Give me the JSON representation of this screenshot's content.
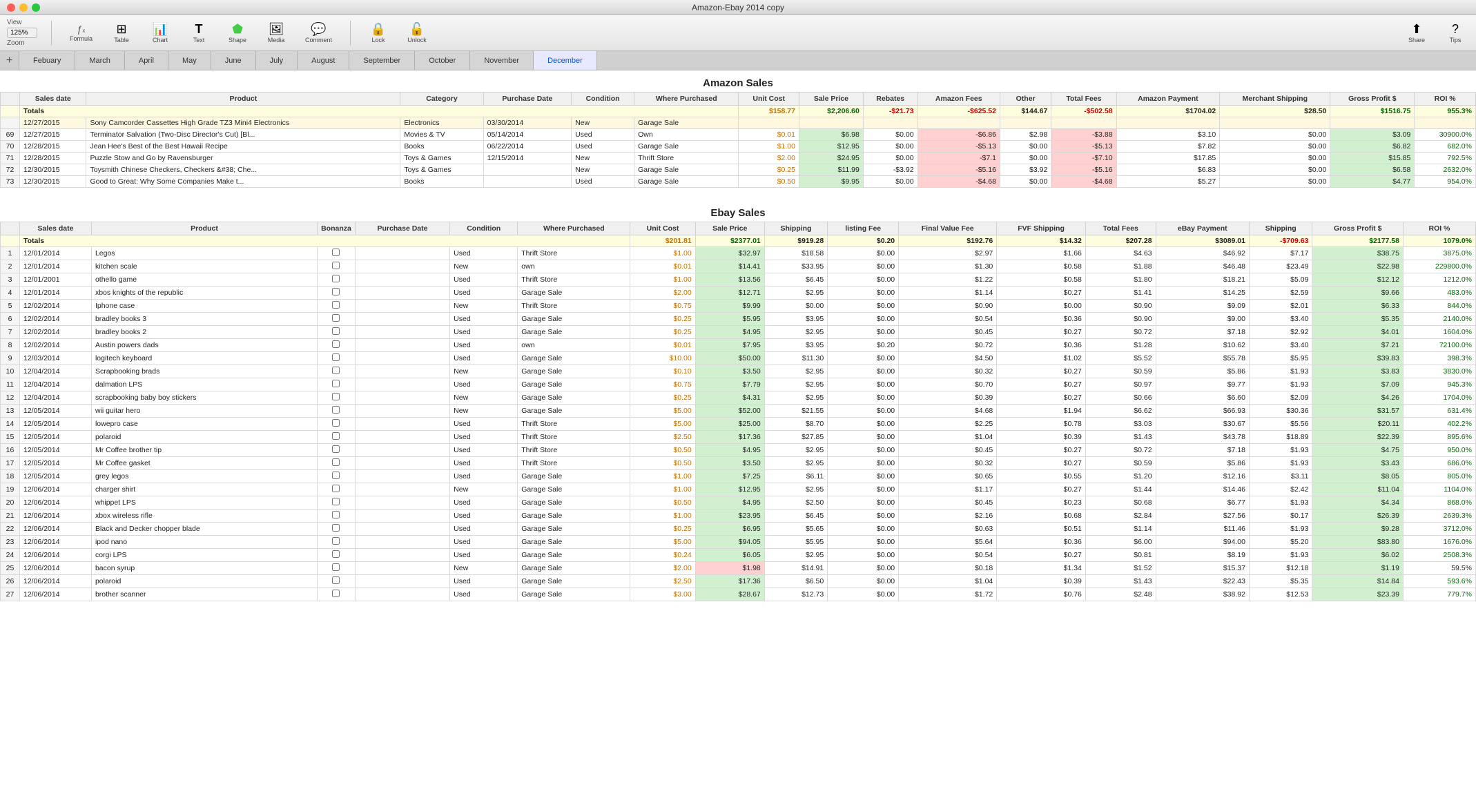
{
  "window": {
    "title": "Amazon-Ebay 2014 copy"
  },
  "toolbar": {
    "view_label": "View",
    "zoom_label": "Zoom",
    "zoom_value": "125%",
    "formula_label": "Formula",
    "table_label": "Table",
    "chart_label": "Chart",
    "text_label": "Text",
    "shape_label": "Shape",
    "media_label": "Media",
    "comment_label": "Comment",
    "lock_label": "Lock",
    "unlock_label": "Unlock",
    "share_label": "Share",
    "tips_label": "Tips"
  },
  "tabs": [
    {
      "label": "Febuary",
      "active": false
    },
    {
      "label": "March",
      "active": false
    },
    {
      "label": "April",
      "active": false
    },
    {
      "label": "May",
      "active": false
    },
    {
      "label": "June",
      "active": false
    },
    {
      "label": "July",
      "active": false
    },
    {
      "label": "August",
      "active": false
    },
    {
      "label": "September",
      "active": false
    },
    {
      "label": "October",
      "active": false
    },
    {
      "label": "November",
      "active": false
    },
    {
      "label": "December",
      "active": true
    }
  ],
  "amazon_section": {
    "title": "Amazon Sales",
    "headers": [
      "Sales date",
      "Product",
      "Category",
      "Purchase Date",
      "Condition",
      "Where Purchased",
      "Unit Cost",
      "Sale Price",
      "Rebates",
      "Amazon Fees",
      "Other",
      "Total Fees",
      "Amazon Payment",
      "Merchant Shipping",
      "Gross Profit $",
      "ROI %"
    ],
    "totals": {
      "label": "Totals",
      "values": [
        "",
        "",
        "",
        "",
        "",
        "$158.77",
        "$2,206.60",
        "-$21.73",
        "-$625.52",
        "$144.67",
        "-$502.58",
        "$1704.02",
        "$28.50",
        "$1516.75",
        "955.3%"
      ]
    },
    "rows": [
      {
        "num": "",
        "date": "12/27/2015",
        "product": "Sony Camcorder Cassettes High Grade TZ3 Mini4 Electronics",
        "category": "Electronics",
        "purchase_date": "03/30/2014",
        "condition": "New",
        "where": "Garage Sale",
        "unit": "",
        "sale": "",
        "rebates": "",
        "amzfee": "",
        "other": "",
        "total": "",
        "payment": "",
        "shipping": "",
        "gross": "",
        "roi": ""
      },
      {
        "num": "69",
        "date": "12/27/2015",
        "product": "Terminator Salvation (Two-Disc Director's Cut) [Bl...",
        "category": "Movies & TV",
        "purchase_date": "05/14/2014",
        "condition": "Used",
        "where": "Own",
        "unit": "$0.01",
        "sale": "$6.98",
        "rebates": "$0.00",
        "amzfee": "-$6.86",
        "other": "$2.98",
        "total": "-$3.88",
        "payment": "$3.10",
        "shipping": "$0.00",
        "gross": "$3.09",
        "roi": "30900.0%"
      },
      {
        "num": "70",
        "date": "12/28/2015",
        "product": "Jean Hee's Best of the Best Hawaii Recipe",
        "category": "Books",
        "purchase_date": "06/22/2014",
        "condition": "Used",
        "where": "Garage Sale",
        "unit": "$1.00",
        "sale": "$12.95",
        "rebates": "$0.00",
        "amzfee": "-$5.13",
        "other": "$0.00",
        "total": "-$5.13",
        "payment": "$7.82",
        "shipping": "$0.00",
        "gross": "$6.82",
        "roi": "682.0%"
      },
      {
        "num": "71",
        "date": "12/28/2015",
        "product": "Puzzle Stow and Go by Ravensburger",
        "category": "Toys & Games",
        "purchase_date": "12/15/2014",
        "condition": "New",
        "where": "Thrift Store",
        "unit": "$2.00",
        "sale": "$24.95",
        "rebates": "$0.00",
        "amzfee": "-$7.1",
        "other": "$0.00",
        "total": "-$7.10",
        "payment": "$17.85",
        "shipping": "$0.00",
        "gross": "$15.85",
        "roi": "792.5%"
      },
      {
        "num": "72",
        "date": "12/30/2015",
        "product": "Toysmith Chinese Checkers, Checkers &#38; Che...",
        "category": "Toys & Games",
        "purchase_date": "",
        "condition": "New",
        "where": "Garage Sale",
        "unit": "$0.25",
        "sale": "$11.99",
        "rebates": "-$3.92",
        "amzfee": "-$5.16",
        "other": "$3.92",
        "total": "-$5.16",
        "payment": "$6.83",
        "shipping": "$0.00",
        "gross": "$6.58",
        "roi": "2632.0%"
      },
      {
        "num": "73",
        "date": "12/30/2015",
        "product": "Good to Great: Why Some Companies Make t...",
        "category": "Books",
        "purchase_date": "",
        "condition": "Used",
        "where": "Garage Sale",
        "unit": "$0.50",
        "sale": "$9.95",
        "rebates": "$0.00",
        "amzfee": "-$4.68",
        "other": "$0.00",
        "total": "-$4.68",
        "payment": "$5.27",
        "shipping": "$0.00",
        "gross": "$4.77",
        "roi": "954.0%"
      }
    ]
  },
  "ebay_section": {
    "title": "Ebay Sales",
    "headers": [
      "Sales date",
      "Product",
      "Bonanza",
      "Purchase Date",
      "Condition",
      "Where Purchased",
      "Unit Cost",
      "Sale Price",
      "Shipping",
      "listing Fee",
      "Final Value Fee",
      "FVF Shipping",
      "Total Fees",
      "eBay Payment",
      "Shipping",
      "Gross Profit $",
      "ROI %"
    ],
    "totals": {
      "label": "Totals",
      "values": [
        "",
        "",
        "",
        "",
        "",
        "$201.81",
        "$2377.01",
        "$919.28",
        "$0.20",
        "$192.76",
        "$14.32",
        "$207.28",
        "$3089.01",
        "-$709.63",
        "$2177.58",
        "1079.0%"
      ]
    },
    "rows": [
      {
        "num": "1",
        "date": "12/01/2014",
        "product": "Legos",
        "bonanza": "",
        "purchase_date": "",
        "condition": "Used",
        "where": "Thrift Store",
        "unit": "$1.00",
        "sale": "$32.97",
        "shipping": "$18.58",
        "listing": "$0.00",
        "fvf": "$2.97",
        "fvfship": "$1.66",
        "total": "$4.63",
        "payment": "$46.92",
        "ship2": "$7.17",
        "gross": "$38.75",
        "roi": "3875.0%"
      },
      {
        "num": "2",
        "date": "12/01/2014",
        "product": "kitchen scale",
        "bonanza": "",
        "purchase_date": "",
        "condition": "New",
        "where": "own",
        "unit": "$0.01",
        "sale": "$14.41",
        "shipping": "$33.95",
        "listing": "$0.00",
        "fvf": "$1.30",
        "fvfship": "$0.58",
        "total": "$1.88",
        "payment": "$46.48",
        "ship2": "$23.49",
        "gross": "$22.98",
        "roi": "229800.0%"
      },
      {
        "num": "3",
        "date": "12/01/2001",
        "product": "othello game",
        "bonanza": "",
        "purchase_date": "",
        "condition": "Used",
        "where": "Thrift Store",
        "unit": "$1.00",
        "sale": "$13.56",
        "shipping": "$6.45",
        "listing": "$0.00",
        "fvf": "$1.22",
        "fvfship": "$0.58",
        "total": "$1.80",
        "payment": "$18.21",
        "ship2": "$5.09",
        "gross": "$12.12",
        "roi": "1212.0%"
      },
      {
        "num": "4",
        "date": "12/01/2014",
        "product": "xbos knights of the republic",
        "bonanza": "",
        "purchase_date": "",
        "condition": "Used",
        "where": "Garage Sale",
        "unit": "$2.00",
        "sale": "$12.71",
        "shipping": "$2.95",
        "listing": "$0.00",
        "fvf": "$1.14",
        "fvfship": "$0.27",
        "total": "$1.41",
        "payment": "$14.25",
        "ship2": "$2.59",
        "gross": "$9.66",
        "roi": "483.0%"
      },
      {
        "num": "5",
        "date": "12/02/2014",
        "product": "Iphone case",
        "bonanza": "",
        "purchase_date": "",
        "condition": "New",
        "where": "Thrift Store",
        "unit": "$0.75",
        "sale": "$9.99",
        "shipping": "$0.00",
        "listing": "$0.00",
        "fvf": "$0.90",
        "fvfship": "$0.00",
        "total": "$0.90",
        "payment": "$9.09",
        "ship2": "$2.01",
        "gross": "$6.33",
        "roi": "844.0%"
      },
      {
        "num": "6",
        "date": "12/02/2014",
        "product": "bradley books 3",
        "bonanza": "",
        "purchase_date": "",
        "condition": "Used",
        "where": "Garage Sale",
        "unit": "$0.25",
        "sale": "$5.95",
        "shipping": "$3.95",
        "listing": "$0.00",
        "fvf": "$0.54",
        "fvfship": "$0.36",
        "total": "$0.90",
        "payment": "$9.00",
        "ship2": "$3.40",
        "gross": "$5.35",
        "roi": "2140.0%"
      },
      {
        "num": "7",
        "date": "12/02/2014",
        "product": "bradley books 2",
        "bonanza": "",
        "purchase_date": "",
        "condition": "Used",
        "where": "Garage Sale",
        "unit": "$0.25",
        "sale": "$4.95",
        "shipping": "$2.95",
        "listing": "$0.00",
        "fvf": "$0.45",
        "fvfship": "$0.27",
        "total": "$0.72",
        "payment": "$7.18",
        "ship2": "$2.92",
        "gross": "$4.01",
        "roi": "1604.0%"
      },
      {
        "num": "8",
        "date": "12/02/2014",
        "product": "Austin powers dads",
        "bonanza": "",
        "purchase_date": "",
        "condition": "Used",
        "where": "own",
        "unit": "$0.01",
        "sale": "$7.95",
        "shipping": "$3.95",
        "listing": "$0.20",
        "fvf": "$0.72",
        "fvfship": "$0.36",
        "total": "$1.28",
        "payment": "$10.62",
        "ship2": "$3.40",
        "gross": "$7.21",
        "roi": "72100.0%"
      },
      {
        "num": "9",
        "date": "12/03/2014",
        "product": "logitech keyboard",
        "bonanza": "",
        "purchase_date": "",
        "condition": "Used",
        "where": "Garage Sale",
        "unit": "$10.00",
        "sale": "$50.00",
        "shipping": "$11.30",
        "listing": "$0.00",
        "fvf": "$4.50",
        "fvfship": "$1.02",
        "total": "$5.52",
        "payment": "$55.78",
        "ship2": "$5.95",
        "gross": "$39.83",
        "roi": "398.3%"
      },
      {
        "num": "10",
        "date": "12/04/2014",
        "product": "Scrapbooking brads",
        "bonanza": "",
        "purchase_date": "",
        "condition": "New",
        "where": "Garage Sale",
        "unit": "$0.10",
        "sale": "$3.50",
        "shipping": "$2.95",
        "listing": "$0.00",
        "fvf": "$0.32",
        "fvfship": "$0.27",
        "total": "$0.59",
        "payment": "$5.86",
        "ship2": "$1.93",
        "gross": "$3.83",
        "roi": "3830.0%"
      },
      {
        "num": "11",
        "date": "12/04/2014",
        "product": "dalmation LPS",
        "bonanza": "",
        "purchase_date": "",
        "condition": "Used",
        "where": "Garage Sale",
        "unit": "$0.75",
        "sale": "$7.79",
        "shipping": "$2.95",
        "listing": "$0.00",
        "fvf": "$0.70",
        "fvfship": "$0.27",
        "total": "$0.97",
        "payment": "$9.77",
        "ship2": "$1.93",
        "gross": "$7.09",
        "roi": "945.3%"
      },
      {
        "num": "12",
        "date": "12/04/2014",
        "product": "scrapbooking baby boy stickers",
        "bonanza": "",
        "purchase_date": "",
        "condition": "New",
        "where": "Garage Sale",
        "unit": "$0.25",
        "sale": "$4.31",
        "shipping": "$2.95",
        "listing": "$0.00",
        "fvf": "$0.39",
        "fvfship": "$0.27",
        "total": "$0.66",
        "payment": "$6.60",
        "ship2": "$2.09",
        "gross": "$4.26",
        "roi": "1704.0%"
      },
      {
        "num": "13",
        "date": "12/05/2014",
        "product": "wii guitar hero",
        "bonanza": "",
        "purchase_date": "",
        "condition": "New",
        "where": "Garage Sale",
        "unit": "$5.00",
        "sale": "$52.00",
        "shipping": "$21.55",
        "listing": "$0.00",
        "fvf": "$4.68",
        "fvfship": "$1.94",
        "total": "$6.62",
        "payment": "$66.93",
        "ship2": "$30.36",
        "gross": "$31.57",
        "roi": "631.4%"
      },
      {
        "num": "14",
        "date": "12/05/2014",
        "product": "lowepro case",
        "bonanza": "",
        "purchase_date": "",
        "condition": "Used",
        "where": "Thrift Store",
        "unit": "$5.00",
        "sale": "$25.00",
        "shipping": "$8.70",
        "listing": "$0.00",
        "fvf": "$2.25",
        "fvfship": "$0.78",
        "total": "$3.03",
        "payment": "$30.67",
        "ship2": "$5.56",
        "gross": "$20.11",
        "roi": "402.2%"
      },
      {
        "num": "15",
        "date": "12/05/2014",
        "product": "polaroid",
        "bonanza": "",
        "purchase_date": "",
        "condition": "Used",
        "where": "Thrift Store",
        "unit": "$2.50",
        "sale": "$17.36",
        "shipping": "$27.85",
        "listing": "$0.00",
        "fvf": "$1.04",
        "fvfship": "$0.39",
        "total": "$1.43",
        "payment": "$43.78",
        "ship2": "$18.89",
        "gross": "$22.39",
        "roi": "895.6%"
      },
      {
        "num": "16",
        "date": "12/05/2014",
        "product": "Mr Coffee brother tip",
        "bonanza": "",
        "purchase_date": "",
        "condition": "Used",
        "where": "Thrift Store",
        "unit": "$0.50",
        "sale": "$4.95",
        "shipping": "$2.95",
        "listing": "$0.00",
        "fvf": "$0.45",
        "fvfship": "$0.27",
        "total": "$0.72",
        "payment": "$7.18",
        "ship2": "$1.93",
        "gross": "$4.75",
        "roi": "950.0%"
      },
      {
        "num": "17",
        "date": "12/05/2014",
        "product": "Mr Coffee gasket",
        "bonanza": "",
        "purchase_date": "",
        "condition": "Used",
        "where": "Thrift Store",
        "unit": "$0.50",
        "sale": "$3.50",
        "shipping": "$2.95",
        "listing": "$0.00",
        "fvf": "$0.32",
        "fvfship": "$0.27",
        "total": "$0.59",
        "payment": "$5.86",
        "ship2": "$1.93",
        "gross": "$3.43",
        "roi": "686.0%"
      },
      {
        "num": "18",
        "date": "12/05/2014",
        "product": "grey legos",
        "bonanza": "",
        "purchase_date": "",
        "condition": "Used",
        "where": "Garage Sale",
        "unit": "$1.00",
        "sale": "$7.25",
        "shipping": "$6.11",
        "listing": "$0.00",
        "fvf": "$0.65",
        "fvfship": "$0.55",
        "total": "$1.20",
        "payment": "$12.16",
        "ship2": "$3.11",
        "gross": "$8.05",
        "roi": "805.0%"
      },
      {
        "num": "19",
        "date": "12/06/2014",
        "product": "charger shirt",
        "bonanza": "",
        "purchase_date": "",
        "condition": "New",
        "where": "Garage Sale",
        "unit": "$1.00",
        "sale": "$12.95",
        "shipping": "$2.95",
        "listing": "$0.00",
        "fvf": "$1.17",
        "fvfship": "$0.27",
        "total": "$1.44",
        "payment": "$14.46",
        "ship2": "$2.42",
        "gross": "$11.04",
        "roi": "1104.0%"
      },
      {
        "num": "20",
        "date": "12/06/2014",
        "product": "whippet LPS",
        "bonanza": "",
        "purchase_date": "",
        "condition": "Used",
        "where": "Garage Sale",
        "unit": "$0.50",
        "sale": "$4.95",
        "shipping": "$2.50",
        "listing": "$0.00",
        "fvf": "$0.45",
        "fvfship": "$0.23",
        "total": "$0.68",
        "payment": "$6.77",
        "ship2": "$1.93",
        "gross": "$4.34",
        "roi": "868.0%"
      },
      {
        "num": "21",
        "date": "12/06/2014",
        "product": "xbox wireless rifle",
        "bonanza": "",
        "purchase_date": "",
        "condition": "Used",
        "where": "Garage Sale",
        "unit": "$1.00",
        "sale": "$23.95",
        "shipping": "$6.45",
        "listing": "$0.00",
        "fvf": "$2.16",
        "fvfship": "$0.68",
        "total": "$2.84",
        "payment": "$27.56",
        "ship2": "$0.17",
        "gross": "$26.39",
        "roi": "2639.3%"
      },
      {
        "num": "22",
        "date": "12/06/2014",
        "product": "Black and Decker chopper blade",
        "bonanza": "",
        "purchase_date": "",
        "condition": "Used",
        "where": "Garage Sale",
        "unit": "$0.25",
        "sale": "$6.95",
        "shipping": "$5.65",
        "listing": "$0.00",
        "fvf": "$0.63",
        "fvfship": "$0.51",
        "total": "$1.14",
        "payment": "$11.46",
        "ship2": "$1.93",
        "gross": "$9.28",
        "roi": "3712.0%"
      },
      {
        "num": "23",
        "date": "12/06/2014",
        "product": "ipod nano",
        "bonanza": "",
        "purchase_date": "",
        "condition": "Used",
        "where": "Garage Sale",
        "unit": "$5.00",
        "sale": "$94.05",
        "shipping": "$5.95",
        "listing": "$0.00",
        "fvf": "$5.64",
        "fvfship": "$0.36",
        "total": "$6.00",
        "payment": "$94.00",
        "ship2": "$5.20",
        "gross": "$83.80",
        "roi": "1676.0%"
      },
      {
        "num": "24",
        "date": "12/06/2014",
        "product": "corgi LPS",
        "bonanza": "",
        "purchase_date": "",
        "condition": "Used",
        "where": "Garage Sale",
        "unit": "$0.24",
        "sale": "$6.05",
        "shipping": "$2.95",
        "listing": "$0.00",
        "fvf": "$0.54",
        "fvfship": "$0.27",
        "total": "$0.81",
        "payment": "$8.19",
        "ship2": "$1.93",
        "gross": "$6.02",
        "roi": "2508.3%"
      },
      {
        "num": "25",
        "date": "12/06/2014",
        "product": "bacon syrup",
        "bonanza": "",
        "purchase_date": "",
        "condition": "New",
        "where": "Garage Sale",
        "unit": "$2.00",
        "sale": "$1.98",
        "shipping": "$14.91",
        "listing": "$0.00",
        "fvf": "$0.18",
        "fvfship": "$1.34",
        "total": "$1.52",
        "payment": "$15.37",
        "ship2": "$12.18",
        "gross": "$1.19",
        "roi": "59.5%"
      },
      {
        "num": "26",
        "date": "12/06/2014",
        "product": "polaroid",
        "bonanza": "",
        "purchase_date": "",
        "condition": "Used",
        "where": "Garage Sale",
        "unit": "$2.50",
        "sale": "$17.36",
        "shipping": "$6.50",
        "listing": "$0.00",
        "fvf": "$1.04",
        "fvfship": "$0.39",
        "total": "$1.43",
        "payment": "$22.43",
        "ship2": "$5.35",
        "gross": "$14.84",
        "roi": "593.6%"
      },
      {
        "num": "27",
        "date": "12/06/2014",
        "product": "brother scanner",
        "bonanza": "",
        "purchase_date": "",
        "condition": "Used",
        "where": "Garage Sale",
        "unit": "$3.00",
        "sale": "$28.67",
        "shipping": "$12.73",
        "listing": "$0.00",
        "fvf": "$1.72",
        "fvfship": "$0.76",
        "total": "$2.48",
        "payment": "$38.92",
        "ship2": "$12.53",
        "gross": "$23.39",
        "roi": "779.7%"
      }
    ]
  }
}
